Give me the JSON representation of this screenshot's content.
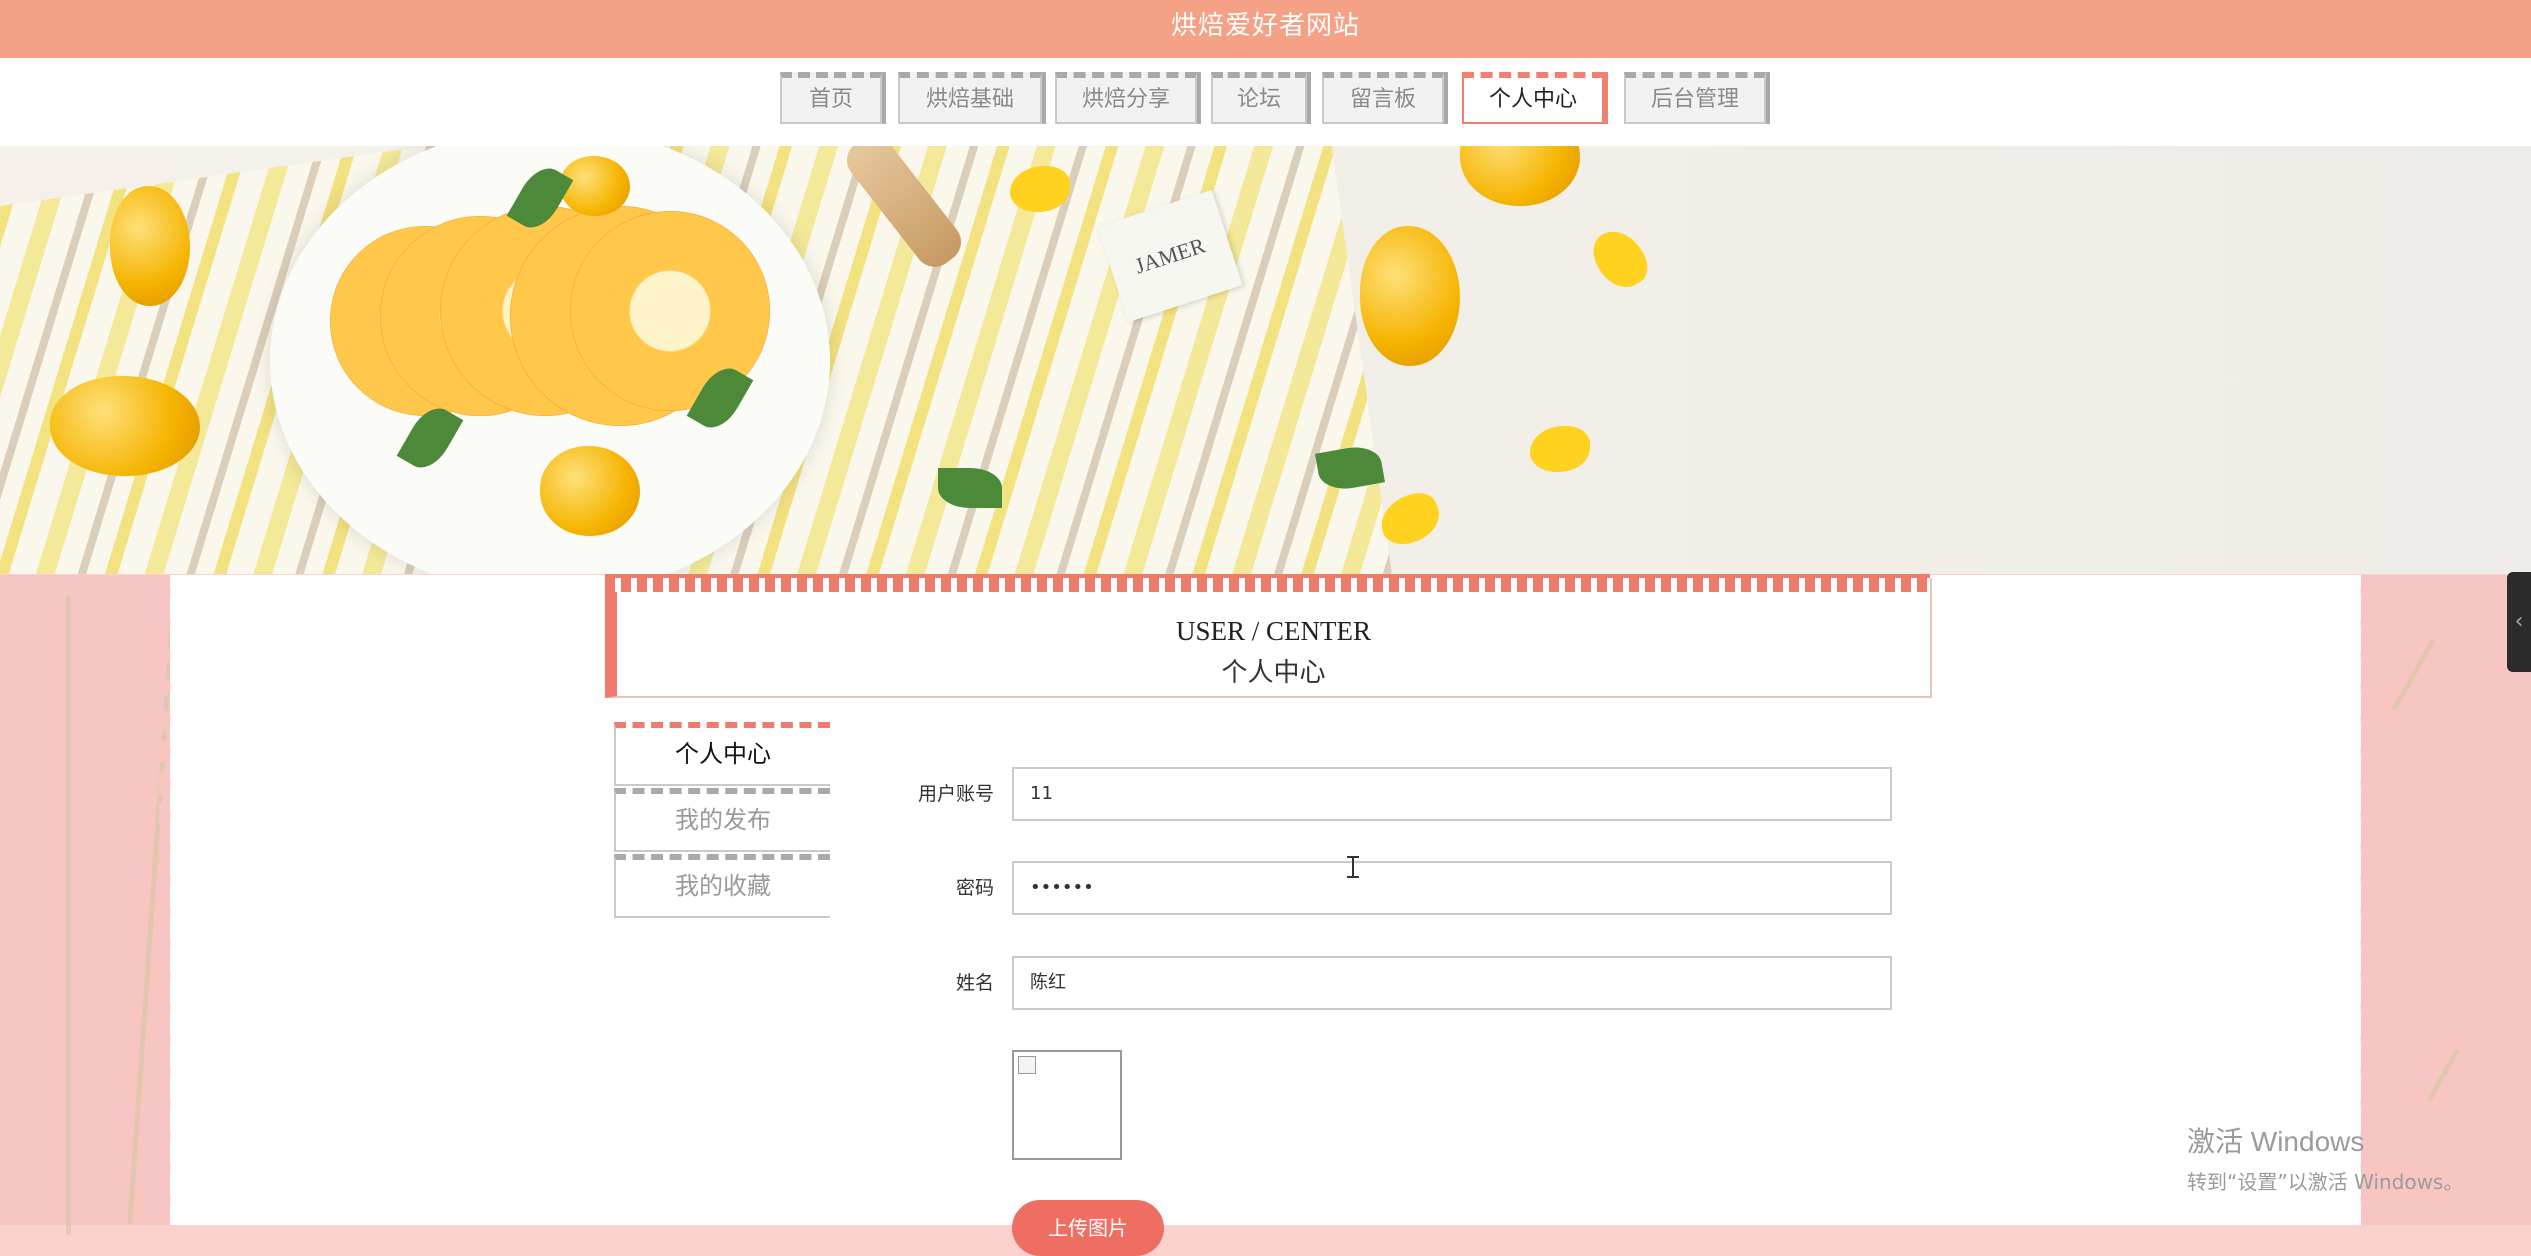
{
  "site": {
    "title": "烘焙爱好者网站"
  },
  "nav": {
    "items": [
      {
        "label": "首页"
      },
      {
        "label": "烘焙基础"
      },
      {
        "label": "烘焙分享"
      },
      {
        "label": "论坛"
      },
      {
        "label": "留言板"
      },
      {
        "label": "个人中心"
      },
      {
        "label": "后台管理"
      }
    ],
    "active": "个人中心"
  },
  "section": {
    "title_en": "USER / CENTER",
    "title_cn": "个人中心"
  },
  "sidebar": {
    "items": [
      {
        "label": "个人中心"
      },
      {
        "label": "我的发布"
      },
      {
        "label": "我的收藏"
      }
    ]
  },
  "form": {
    "account": {
      "label": "用户账号",
      "value": "11"
    },
    "password": {
      "label": "密码",
      "value": "••••••"
    },
    "name": {
      "label": "姓名",
      "value": "陈红"
    },
    "upload_label": "上传图片"
  },
  "watermark": {
    "line1": "激活 Windows",
    "line2": "转到“设置”以激活 Windows。"
  },
  "colors": {
    "header": "#f4a186",
    "accent": "#ee7b6c",
    "page_bg": "#fbd1cd"
  }
}
